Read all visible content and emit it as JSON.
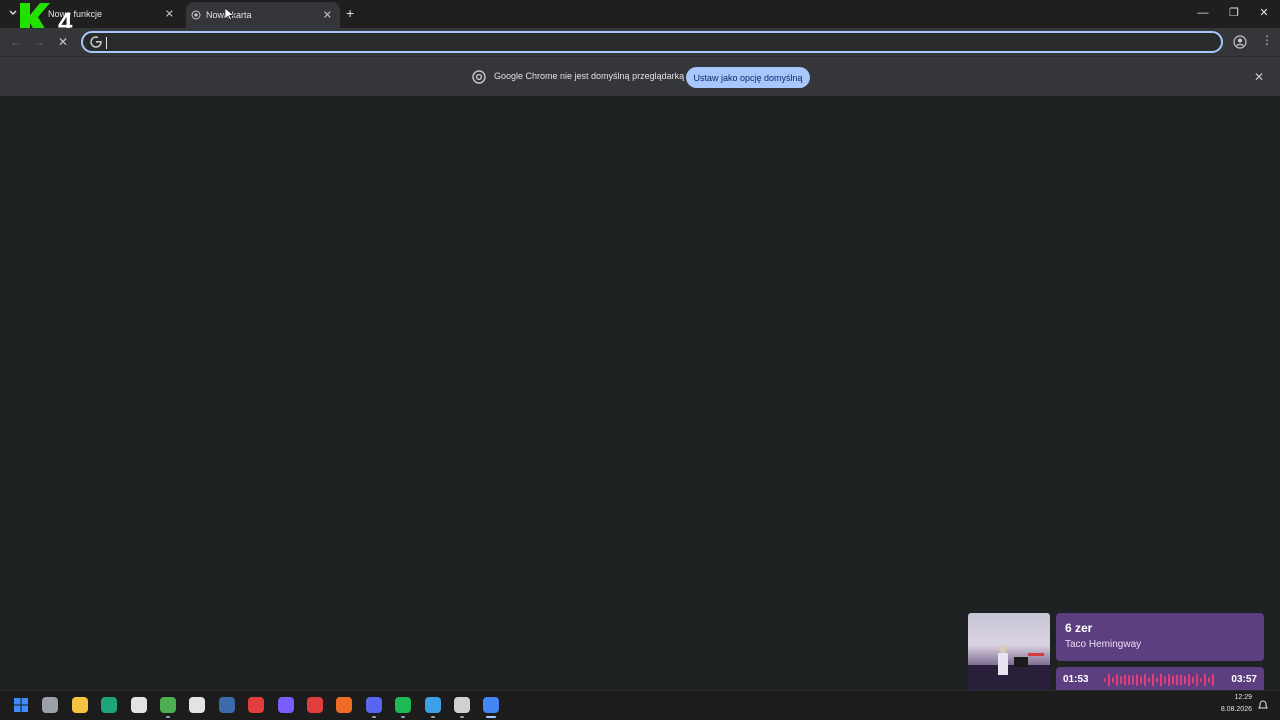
{
  "tabs": [
    {
      "title": "Nowe funkcje",
      "active": false
    },
    {
      "title": "Nowa karta",
      "active": true
    }
  ],
  "new_tab_label": "+",
  "window_controls": {
    "minimize": "—",
    "maximize": "❐",
    "close": "✕"
  },
  "omnibox": {
    "value": "",
    "placeholder": ""
  },
  "infobar": {
    "message": "Google Chrome nie jest domyślną przeglądarką",
    "button_label": "Ustaw jako opcję domyślną",
    "close": "✕"
  },
  "overlay_logo": {
    "text": "4"
  },
  "music": {
    "title": "6 zer",
    "artist": "Taco Hemingway",
    "elapsed": "01:53",
    "total": "03:57",
    "progress_fraction": 0.476,
    "accent_color": "#e23d75",
    "card_color": "#5d3f81"
  },
  "taskbar": {
    "icons": [
      "windows-start-icon",
      "settings-icon",
      "file-explorer-icon",
      "edge-icon",
      "capcut-icon",
      "minecraft-icon",
      "epic-games-icon",
      "steam-icon",
      "obs-icon",
      "app-launcher-icon",
      "opera-gx-icon",
      "brave-icon",
      "discord-icon",
      "spotify-icon",
      "notepad-icon",
      "chatgpt-icon",
      "chrome-icon"
    ],
    "time": "12:29",
    "date": "8.08.2026"
  },
  "colors": {
    "accent": "#a8c7fa",
    "background": "#1f2223",
    "toolbar": "#35363a"
  }
}
